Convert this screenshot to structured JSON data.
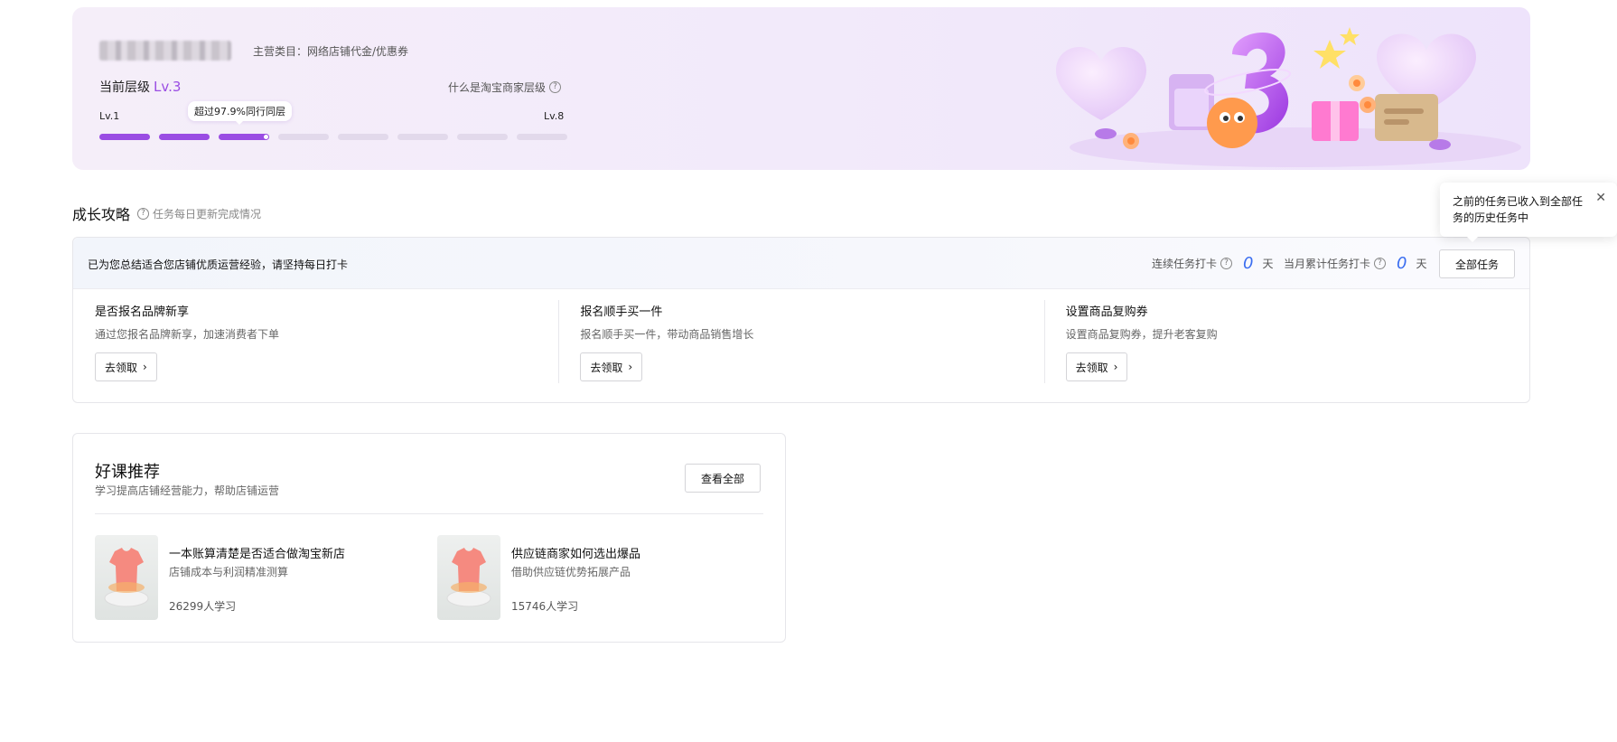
{
  "banner": {
    "category": "主营类目：网络店铺代金/优惠券",
    "level_label": "当前层级",
    "level_value": "Lv.3",
    "what_is_level": "什么是淘宝商家层级",
    "min_level": "Lv.1",
    "max_level": "Lv.8",
    "rank_tooltip": "超过97.9%同行同层",
    "progress": {
      "current_level": 3,
      "total_levels": 8
    },
    "accent_color": "#9a4de3"
  },
  "growth": {
    "title": "成长攻略",
    "subtitle": "任务每日更新完成情况",
    "notice": "已为您总结适合您店铺优质运营经验，请坚持每日打卡",
    "streak_label": "连续任务打卡",
    "streak_value": "0",
    "streak_unit": "天",
    "monthly_label": "当月累计任务打卡",
    "monthly_value": "0",
    "monthly_unit": "天",
    "all_tasks_label": "全部任务",
    "tasks": [
      {
        "title": "是否报名品牌新享",
        "desc": "通过您报名品牌新享，加速消费者下单",
        "button": "去领取"
      },
      {
        "title": "报名顺手买一件",
        "desc": "报名顺手买一件，带动商品销售增长",
        "button": "去领取"
      },
      {
        "title": "设置商品复购券",
        "desc": "设置商品复购券，提升老客复购",
        "button": "去领取"
      }
    ],
    "popover": {
      "text": "之前的任务已收入到全部任务的历史任务中"
    }
  },
  "courses": {
    "title": "好课推荐",
    "subtitle": "学习提高店铺经营能力，帮助店铺运营",
    "view_all": "查看全部",
    "items": [
      {
        "title": "一本账算清楚是否适合做淘宝新店",
        "desc": "店铺成本与利润精准测算",
        "learners": "26299人学习"
      },
      {
        "title": "供应链商家如何选出爆品",
        "desc": "借助供应链优势拓展产品",
        "learners": "15746人学习"
      }
    ]
  },
  "icons": {
    "help": "help-circle-icon",
    "close": "close-icon",
    "chevron": "chevron-right-icon"
  }
}
